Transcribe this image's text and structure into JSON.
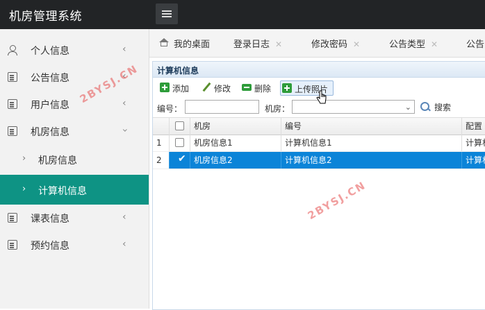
{
  "app": {
    "title": "机房管理系统"
  },
  "sidebar": {
    "items": [
      {
        "label": "个人信息",
        "icon": "person-icon"
      },
      {
        "label": "公告信息",
        "icon": "document-icon"
      },
      {
        "label": "用户信息",
        "icon": "document-icon"
      },
      {
        "label": "机房信息",
        "icon": "document-icon",
        "expanded": true
      },
      {
        "label": "课表信息",
        "icon": "document-icon"
      },
      {
        "label": "预约信息",
        "icon": "document-icon"
      }
    ],
    "sub_items": [
      {
        "label": "机房信息",
        "active": false
      },
      {
        "label": "计算机信息",
        "active": true
      }
    ]
  },
  "tabs": [
    {
      "label": "我的桌面",
      "closable": false
    },
    {
      "label": "登录日志",
      "closable": true
    },
    {
      "label": "修改密码",
      "closable": true
    },
    {
      "label": "公告类型",
      "closable": true
    },
    {
      "label": "公告",
      "closable": false
    }
  ],
  "panel": {
    "title": "计算机信息",
    "toolbar": {
      "add": "添加",
      "edit": "修改",
      "delete": "删除",
      "upload": "上传照片"
    },
    "search": {
      "number_label": "编号：",
      "number_value": "",
      "room_label": "机房：",
      "room_value": "",
      "search_label": "搜索"
    },
    "grid": {
      "columns": [
        "机房",
        "编号",
        "配置"
      ],
      "rows": [
        {
          "index": "1",
          "checked": false,
          "room": "机房信息1",
          "number": "计算机信息1",
          "config": "计算机"
        },
        {
          "index": "2",
          "checked": true,
          "room": "机房信息2",
          "number": "计算机信息2",
          "config": "计算机"
        }
      ]
    }
  },
  "watermark": "2BYSJ.CN",
  "colors": {
    "topbar": "#222426",
    "sidebar_active": "#0e9384",
    "row_selected": "#0b84d8"
  }
}
